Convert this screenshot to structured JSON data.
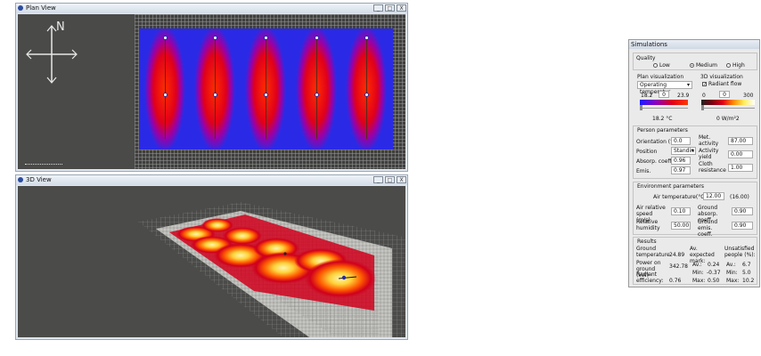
{
  "plan_window": {
    "title": "Plan View",
    "buttons": [
      "_",
      "□",
      "X"
    ],
    "compass_label": "N"
  },
  "view3d_window": {
    "title": "3D View",
    "buttons": [
      "_",
      "□",
      "X"
    ]
  },
  "simulations": {
    "title": "Simulations",
    "quality": {
      "label": "Quality",
      "options": [
        "Low",
        "Medium",
        "High"
      ],
      "selected": "Medium"
    },
    "plan_visualization": {
      "label": "Plan visualization",
      "select_value": "Operating temperatur",
      "scale_min": "18.2",
      "scale_marker": "0",
      "scale_max": "23.9",
      "readout": "18.2 °C"
    },
    "visualization_3d": {
      "label": "3D visualization",
      "checkbox_label": "Radiant flow",
      "checked": true,
      "scale_min": "0",
      "scale_marker": "0",
      "scale_max": "300",
      "readout": "0 W/m²2"
    },
    "person": {
      "label": "Person parameters",
      "orientation_label": "Orientation (°)",
      "orientation_value": "0.0",
      "position_label": "Position",
      "position_value": "Standin",
      "absorp_label": "Absorp. coeff.",
      "absorp_value": "0.96",
      "emis_label": "Emis.",
      "emis_value": "0.97",
      "met_label": "Met. activity",
      "met_value": "87.00",
      "activity_label": "Activity yield",
      "activity_value": "0.00",
      "cloth_label": "Cloth resistance",
      "cloth_value": "1.00"
    },
    "environment": {
      "label": "Environment parameters",
      "air_temp_label": "Air temperature(°C)",
      "air_temp_value": "12.00",
      "air_temp_extra": "(16.00)",
      "air_speed_label": "Air relative speed (m/s)",
      "air_speed_value": "0.10",
      "humidity_label": "Relative humidity",
      "humidity_value": "50.00",
      "ground_absorp_label": "Ground absorp. coeff.",
      "ground_absorp_value": "0.90",
      "ground_emis_label": "Ground emis. coeff.",
      "ground_emis_value": "0.90"
    },
    "results": {
      "label": "Results",
      "ground_temp_label": "Ground temperature",
      "ground_temp_value": "24.89",
      "power_label": "Power on ground (kW)",
      "power_value": "342.78",
      "radiant_label": "Radiant efficiency:",
      "radiant_value": "0.76",
      "expected_header": "Av. expected mark:",
      "unsatisfied_header": "Unsatisfied people (%):",
      "av_label": "Av.:",
      "min_label": "Min:",
      "max_label": "Max:",
      "exp_av": "0.24",
      "exp_min": "-0.37",
      "exp_max": "0.50",
      "uns_av": "6.7",
      "uns_min": "5.0",
      "uns_max": "10.2"
    }
  }
}
